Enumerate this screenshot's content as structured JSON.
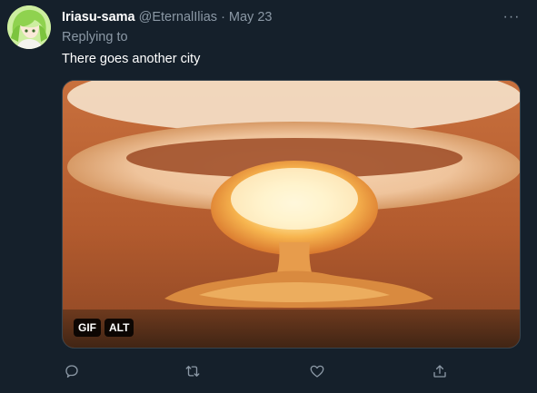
{
  "tweet": {
    "display_name": "Iriasu-sama",
    "handle": "@EternalIlias",
    "separator": "·",
    "date": "May 23",
    "replying_to": "Replying to",
    "text": "There goes another city",
    "more_glyph": "···"
  },
  "media": {
    "badges": [
      "GIF",
      "ALT"
    ],
    "description_icon": "mushroom-cloud-explosion"
  },
  "actions": {
    "icons": [
      "reply-icon",
      "retweet-icon",
      "like-icon",
      "share-icon"
    ]
  },
  "colors": {
    "background": "#15202b",
    "secondary_text": "#8b98a5",
    "icon": "#8b98a5"
  }
}
